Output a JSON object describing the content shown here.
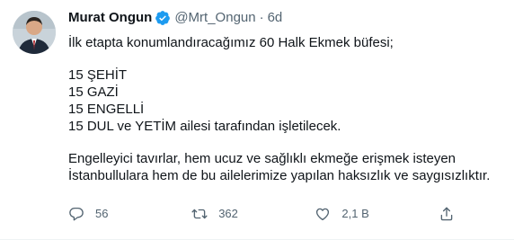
{
  "author": {
    "name": "Murat Ongun",
    "handle": "@Mrt_Ongun",
    "separator": "·",
    "time": "6d"
  },
  "tweet": {
    "line1": "İlk etapta konumlandıracağımız 60 Halk Ekmek büfesi;",
    "line2": "15 ŞEHİT",
    "line3": "15 GAZİ",
    "line4": "15 ENGELLİ",
    "line5": "15 DUL ve YETİM ailesi tarafından işletilecek.",
    "line6": "Engelleyici tavırlar, hem ucuz ve sağlıklı ekmeğe erişmek isteyen",
    "line7": "İstanbullulara hem de bu ailelerimize yapılan haksızlık ve saygısızlıktır."
  },
  "actions": {
    "reply_count": "56",
    "retweet_count": "362",
    "like_count": "2,1 B",
    "share_icon": "share-icon"
  },
  "colors": {
    "text": "#0f1419",
    "secondary": "#536471",
    "verified": "#1d9bf0"
  }
}
